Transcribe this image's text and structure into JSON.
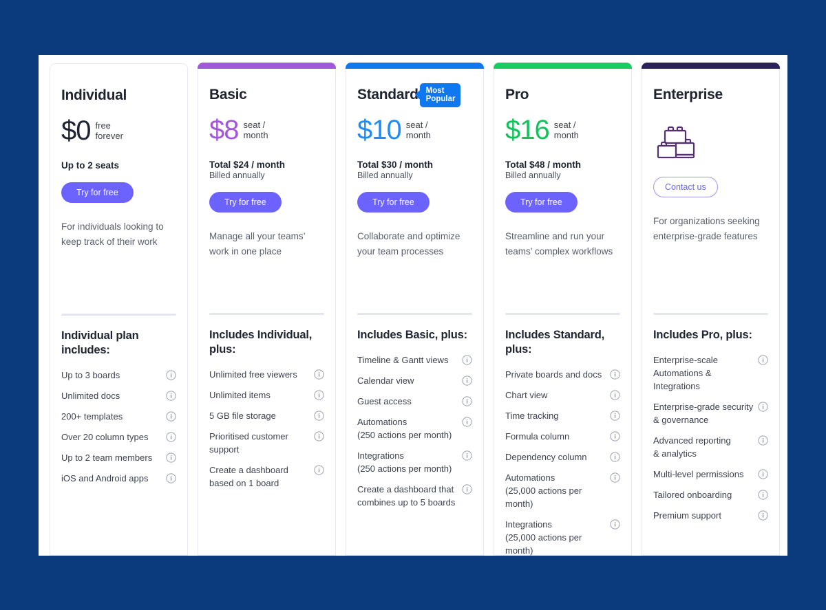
{
  "theme": {
    "page_bg": "#0b3b7c",
    "panel_bg": "#ffffff",
    "primary_button": "#6c63ff",
    "badge_color": "#0f77f0"
  },
  "plans": [
    {
      "id": "individual",
      "name": "Individual",
      "accent": "",
      "price": "$0",
      "price_color": "#1f2430",
      "price_unit": "free\nforever",
      "seats": "Up to 2 seats",
      "total": "",
      "billed": "",
      "cta": "Try for free",
      "cta_type": "primary",
      "description": "For individuals looking to keep track of their work",
      "features_title": "Individual plan includes:",
      "features": [
        "Up to 3 boards",
        "Unlimited docs",
        "200+ templates",
        "Over 20 column types",
        "Up to 2 team members",
        "iOS and Android apps"
      ]
    },
    {
      "id": "basic",
      "name": "Basic",
      "accent": "#a martinez",
      "accent_color": "#a259d9",
      "price": "$8",
      "price_color": "#a259d9",
      "price_unit": "seat /\nmonth",
      "seats": "",
      "total": "Total $24 / month",
      "billed": "Billed annually",
      "cta": "Try for free",
      "cta_type": "primary",
      "description": "Manage all your teams’ work in one place",
      "features_title": "Includes Individual, plus:",
      "features": [
        "Unlimited free viewers",
        "Unlimited items",
        "5 GB file storage",
        "Prioritised customer support",
        "Create a dashboard based on 1 board"
      ]
    },
    {
      "id": "standard",
      "name": "Standard",
      "badge": "Most\nPopular",
      "accent_color": "#0f77f0",
      "price": "$10",
      "price_color": "#1f8cf5",
      "price_unit": "seat /\nmonth",
      "seats": "",
      "total": "Total $30 / month",
      "billed": "Billed annually",
      "cta": "Try for free",
      "cta_type": "primary",
      "description": "Collaborate and optimize your team processes",
      "features_title": "Includes Basic, plus:",
      "features": [
        "Timeline & Gantt views",
        "Calendar view",
        "Guest access",
        "Automations\n(250 actions per month)",
        "Integrations\n(250 actions per month)",
        "Create a dashboard that combines up to 5 boards"
      ]
    },
    {
      "id": "pro",
      "name": "Pro",
      "accent_color": "#16cc63",
      "price": "$16",
      "price_color": "#14c25d",
      "price_unit": "seat /\nmonth",
      "seats": "",
      "total": "Total $48 / month",
      "billed": "Billed annually",
      "cta": "Try for free",
      "cta_type": "primary",
      "description": "Streamline and run your teams’ complex workflows",
      "features_title": "Includes Standard, plus:",
      "features": [
        "Private boards and docs",
        "Chart view",
        "Time tracking",
        "Formula column",
        "Dependency column",
        "Automations\n(25,000 actions per month)",
        "Integrations\n(25,000 actions per month)"
      ]
    },
    {
      "id": "enterprise",
      "name": "Enterprise",
      "accent_color": "#2b2259",
      "price": "",
      "price_color": "",
      "price_unit": "",
      "seats": "",
      "total": "",
      "billed": "",
      "cta": "Contact us",
      "cta_type": "outline",
      "icon": "blocks-icon",
      "description": "For organizations seeking enterprise-grade features",
      "features_title": "Includes Pro, plus:",
      "features": [
        "Enterprise-scale Automations & Integrations",
        "Enterprise-grade security\n& governance",
        "Advanced reporting\n& analytics",
        "Multi-level permissions",
        "Tailored onboarding",
        "Premium support"
      ]
    }
  ]
}
